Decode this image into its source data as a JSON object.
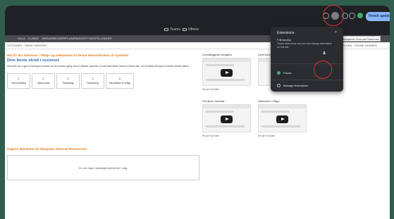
{
  "browser": {
    "bookmarks": [
      "Teams",
      "Others"
    ],
    "finish_update": "Finish update"
  },
  "app": {
    "nav": [
      "SALG",
      "KUNDE",
      "MEDARBEJDERPLANER",
      "UDGIFT",
      "INDSTILLINGER"
    ],
    "subtitle": "VITTIGHED - DEMO VERSION",
    "user_select": "Benjamin Overvad Rasmuss",
    "user_right": "HANS NIELSEN - FELINE HANSEN"
  },
  "welcome": "Hej for din interesse i Vittigo og velkommen til denne demonstration af systemet",
  "first_steps": {
    "title": "Dine første skridt i systemet",
    "desc": "Herunder har vi gjort et forslag til hvordan du kan komme igang med at afprøve systemet. Du kan altid starte forfra fra denne side, ved at klikke på logoet i øverste venstre hjørne.",
    "steps": [
      {
        "num": "1",
        "label": "Opret afdeling"
      },
      {
        "num": "2",
        "label": "Opret ansat"
      },
      {
        "num": "3",
        "label": "Tidsstyring"
      },
      {
        "num": "4",
        "label": "Fakturering"
      },
      {
        "num": "5",
        "label": "Introduktion til Vittigo"
      }
    ]
  },
  "videos": [
    {
      "title": "Grundlæggende navigation",
      "caption": "Se på YouTube"
    },
    {
      "title": "Opret kunde",
      "caption": "Se på YouTube"
    },
    {
      "title": "Find timer i kalender",
      "caption": "Se på YouTube"
    },
    {
      "title": "Kalenderen i Vittigo",
      "caption": "Se på YouTube"
    }
  ],
  "today": {
    "title": "Dagens aktiviteter for Benjamin Overvad Rasmussen",
    "empty": "Du har ingen planlagte aktiviteter i dag."
  },
  "extensions_panel": {
    "title": "Extensions",
    "close": "×",
    "full_access": "Full access",
    "desc": "These extensions can see and change information on this site.",
    "item": "Fauna",
    "manage": "Manage Extensions"
  },
  "colors": {
    "backdrop": "#2f5e4d",
    "orange": "#e07b1a",
    "blue": "#3a6fb0",
    "annotation": "#e0302e"
  }
}
